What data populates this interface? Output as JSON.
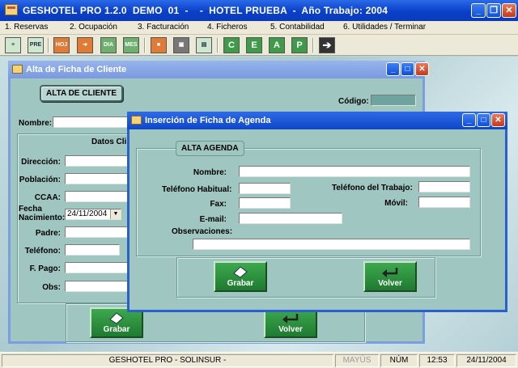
{
  "app": {
    "title": "GESHOTEL PRO 1.2.0  DEMO  01  -    -  HOTEL PRUEBA  -  Año Trabajo: 2004"
  },
  "menu": [
    "1. Reservas",
    "2. Ocupación",
    "3. Facturación",
    "4. Ficheros",
    "5. Contabilidad",
    "6. Utilidades / Terminar"
  ],
  "toolbar": {
    "icons": [
      "list-icon",
      "PRE",
      "HOJ",
      "export-icon",
      "DIA",
      "MES",
      "stop-icon",
      "save-disk-icon",
      "document-icon",
      "C",
      "E",
      "A",
      "P",
      "exit-arrow-icon"
    ]
  },
  "status": {
    "app": "GESHOTEL PRO  -  SOLINSUR  -",
    "caps": "MAYÚS",
    "num": "NÚM",
    "time": "12:53",
    "date": "24/11/2004"
  },
  "client_window": {
    "title": "Alta de Ficha de Cliente",
    "header": "ALTA DE CLIENTE",
    "codigo_label": "Código:",
    "nombre_label": "Nombre:",
    "datos_label": "Datos Cli",
    "direccion_label": "Dirección:",
    "poblacion_label": "Población:",
    "ccaa_label": "CCAA:",
    "fecha_label_1": "Fecha",
    "fecha_label_2": "Nacimiento:",
    "fecha_value": "24/11/2004",
    "padre_label": "Padre:",
    "telefono_label": "Teléfono:",
    "fpago_label": "F. Pago:",
    "obs_label": "Obs:",
    "grabar_label": "Grabar",
    "volver_label": "Volver"
  },
  "agenda_window": {
    "title": "Inserción de Ficha de Agenda",
    "header": "ALTA AGENDA",
    "nombre_label": "Nombre:",
    "tel_habitual_label": "Teléfono Habitual:",
    "tel_trabajo_label": "Teléfono del Trabajo:",
    "fax_label": "Fax:",
    "movil_label": "Móvil:",
    "email_label": "E-mail:",
    "observaciones_label": "Observaciones:",
    "grabar_label": "Grabar",
    "volver_label": "Volver"
  },
  "colors": {
    "titlebar": "#0a3fc9",
    "form_bg": "#9fc6c0",
    "button_green": "#2f8f40"
  }
}
